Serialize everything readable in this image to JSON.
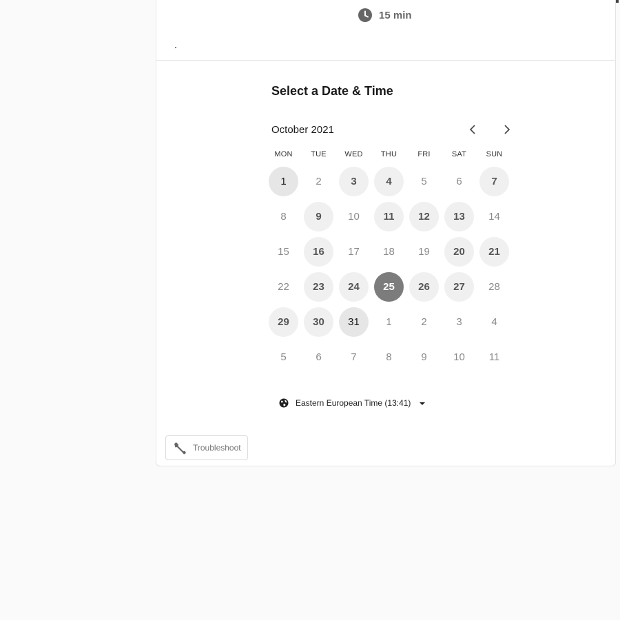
{
  "event": {
    "duration": "15 min",
    "duration_icon": "clock-icon"
  },
  "scheduler": {
    "title": "Select a Date & Time",
    "month": "October 2021",
    "prev_icon": "chevron-left-icon",
    "next_icon": "chevron-right-icon",
    "weekdays": [
      "MON",
      "TUE",
      "WED",
      "THU",
      "FRI",
      "SAT",
      "SUN"
    ],
    "days": [
      {
        "label": "1",
        "state": "today"
      },
      {
        "label": "2",
        "state": "off"
      },
      {
        "label": "3",
        "state": "avail"
      },
      {
        "label": "4",
        "state": "avail"
      },
      {
        "label": "5",
        "state": "off"
      },
      {
        "label": "6",
        "state": "off"
      },
      {
        "label": "7",
        "state": "avail"
      },
      {
        "label": "8",
        "state": "off"
      },
      {
        "label": "9",
        "state": "avail"
      },
      {
        "label": "10",
        "state": "off"
      },
      {
        "label": "11",
        "state": "avail"
      },
      {
        "label": "12",
        "state": "avail"
      },
      {
        "label": "13",
        "state": "avail"
      },
      {
        "label": "14",
        "state": "off"
      },
      {
        "label": "15",
        "state": "off"
      },
      {
        "label": "16",
        "state": "avail"
      },
      {
        "label": "17",
        "state": "off"
      },
      {
        "label": "18",
        "state": "off"
      },
      {
        "label": "19",
        "state": "off"
      },
      {
        "label": "20",
        "state": "avail"
      },
      {
        "label": "21",
        "state": "avail"
      },
      {
        "label": "22",
        "state": "off"
      },
      {
        "label": "23",
        "state": "avail"
      },
      {
        "label": "24",
        "state": "avail"
      },
      {
        "label": "25",
        "state": "selected"
      },
      {
        "label": "26",
        "state": "avail"
      },
      {
        "label": "27",
        "state": "avail"
      },
      {
        "label": "28",
        "state": "off"
      },
      {
        "label": "29",
        "state": "avail"
      },
      {
        "label": "30",
        "state": "avail"
      },
      {
        "label": "31",
        "state": "today"
      },
      {
        "label": "1",
        "state": "off"
      },
      {
        "label": "2",
        "state": "off"
      },
      {
        "label": "3",
        "state": "off"
      },
      {
        "label": "4",
        "state": "off"
      },
      {
        "label": "5",
        "state": "off"
      },
      {
        "label": "6",
        "state": "off"
      },
      {
        "label": "7",
        "state": "off"
      },
      {
        "label": "8",
        "state": "off"
      },
      {
        "label": "9",
        "state": "off"
      },
      {
        "label": "10",
        "state": "off"
      },
      {
        "label": "11",
        "state": "off"
      }
    ],
    "timezone": "Eastern European Time (13:41)",
    "timezone_icon": "globe-icon"
  },
  "footer": {
    "troubleshoot_label": "Troubleshoot",
    "troubleshoot_icon": "wrench-icon"
  },
  "colors": {
    "selected_day": "#7c7c7c",
    "available_day": "#f0f0f0",
    "page_background": "#fafafa"
  }
}
